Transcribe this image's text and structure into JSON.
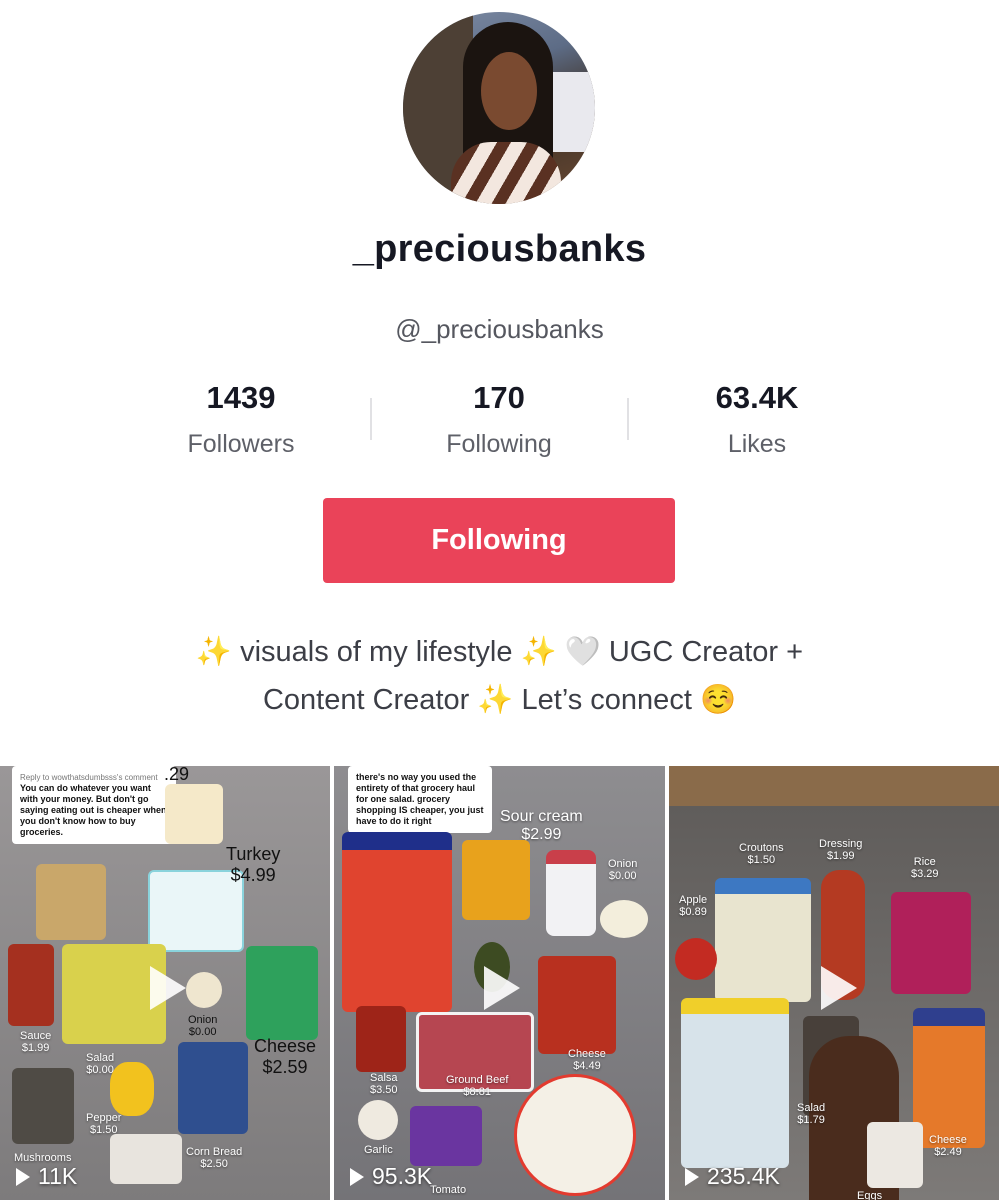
{
  "profile": {
    "name": "_preciousbanks",
    "handle": "@_preciousbanks"
  },
  "stats": [
    {
      "value": "1439",
      "label": "Followers"
    },
    {
      "value": "170",
      "label": "Following"
    },
    {
      "value": "63.4K",
      "label": "Likes"
    }
  ],
  "follow_button": "Following",
  "bio": {
    "line1": [
      "✨",
      " visuals of my lifestyle ",
      "✨",
      " 🤍 ",
      "UGC Creator +"
    ],
    "line2": [
      "Content Creator ",
      "✨",
      " Let’s connect ",
      "☺️"
    ]
  },
  "videos": [
    {
      "views": "11K",
      "comment_reply": "Reply to wowthatsdumbsss's comment",
      "comment": "You can do whatever you want with your money. But don't go saying eating out is cheaper when you don't know how to buy groceries.",
      "labels": [
        {
          "item": "Turkey",
          "price": "$4.99"
        },
        {
          "item": "Cheese",
          "price": "$2.59"
        },
        {
          "item": "Onion",
          "price": "$0.00"
        },
        {
          "item": "Sauce",
          "price": "$1.99"
        },
        {
          "item": "Salad",
          "price": "$0.00"
        },
        {
          "item": "Pepper",
          "price": "$1.50"
        },
        {
          "item": "Mushrooms",
          "price": ""
        },
        {
          "item": "Corn Bread",
          "price": "$2.50"
        },
        {
          "item": ".29",
          "price": ""
        }
      ]
    },
    {
      "views": "95.3K",
      "comment": "there's no way you used the entirety of that grocery haul for one salad. grocery shopping IS cheaper, you just have to do it right",
      "labels": [
        {
          "item": "Sour cream",
          "price": "$2.99"
        },
        {
          "item": "Onion",
          "price": "$0.00"
        },
        {
          "item": "Cheese",
          "price": "$4.49"
        },
        {
          "item": "Salsa",
          "price": "$3.50"
        },
        {
          "item": "Ground Beef",
          "price": "$8.81"
        },
        {
          "item": "Garlic",
          "price": ""
        },
        {
          "item": "Tomato",
          "price": ""
        }
      ]
    },
    {
      "views": "235.4K",
      "labels": [
        {
          "item": "Croutons",
          "price": "$1.50"
        },
        {
          "item": "Dressing",
          "price": "$1.99"
        },
        {
          "item": "Rice",
          "price": "$3.29"
        },
        {
          "item": "Apple",
          "price": "$0.89"
        },
        {
          "item": "Salad",
          "price": "$1.79"
        },
        {
          "item": "Cheese",
          "price": "$2.49"
        },
        {
          "item": "Eggs",
          "price": ""
        }
      ]
    }
  ]
}
